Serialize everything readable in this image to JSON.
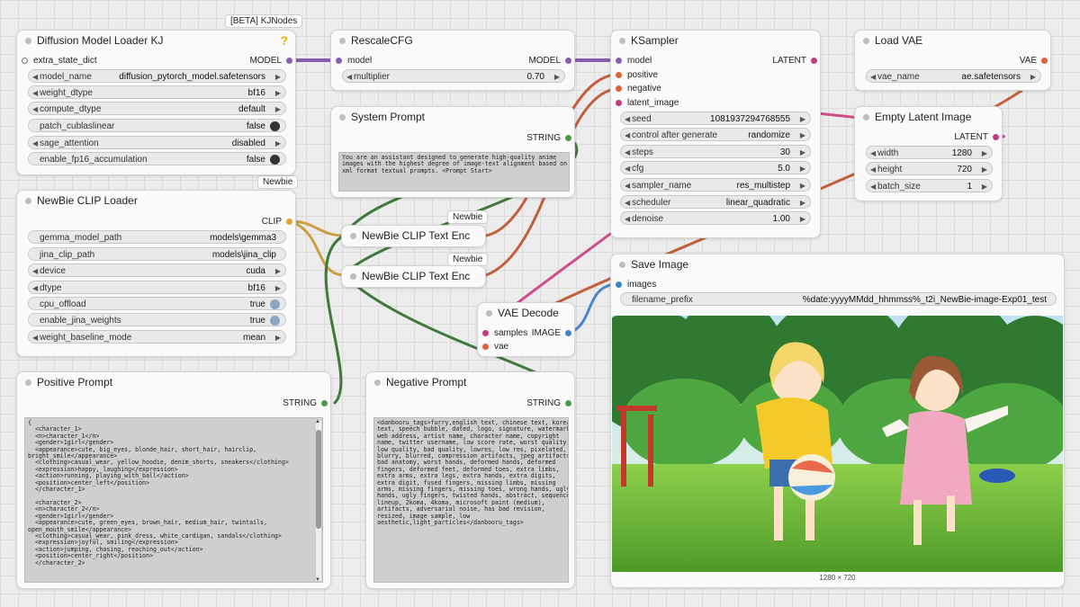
{
  "colors": {
    "model": "#8a5cad",
    "clip": "#e8a33a",
    "string": "#4f9a4a",
    "latent": "#c43c7f",
    "vae": "#e0603a",
    "image": "#3d85c6",
    "wire_clip": "#c9a040",
    "wire_string": "#3f7a3a",
    "wire_model": "#8a5cad",
    "wire_latent": "#cc4f8a",
    "wire_vae": "#c0603c",
    "wire_image": "#4a86c8"
  },
  "badges": {
    "kjnodes": "[BETA] KJNodes",
    "newbie_loader": "Newbie",
    "newbie_enc1": "Newbie",
    "newbie_enc2": "Newbie"
  },
  "diffusion_loader": {
    "title": "Diffusion Model Loader KJ",
    "help_icon": "?",
    "input": "extra_state_dict",
    "output": "MODEL",
    "widgets": [
      {
        "label": "model_name",
        "value": "diffusion_pytorch_model.safetensors"
      },
      {
        "label": "weight_dtype",
        "value": "bf16"
      },
      {
        "label": "compute_dtype",
        "value": "default"
      },
      {
        "label": "patch_cublaslinear",
        "value": "false"
      },
      {
        "label": "sage_attention",
        "value": "disabled"
      },
      {
        "label": "enable_fp16_accumulation",
        "value": "false"
      }
    ]
  },
  "clip_loader": {
    "title": "NewBie CLIP Loader",
    "output": "CLIP",
    "widgets": [
      {
        "label": "gemma_model_path",
        "value": "models\\gemma3"
      },
      {
        "label": "jina_clip_path",
        "value": "models\\jina_clip"
      },
      {
        "label": "device",
        "value": "cuda"
      },
      {
        "label": "dtype",
        "value": "bf16"
      },
      {
        "label": "cpu_offload",
        "value": "true"
      },
      {
        "label": "enable_jina_weights",
        "value": "true"
      },
      {
        "label": "weight_baseline_mode",
        "value": "mean"
      }
    ]
  },
  "rescale": {
    "title": "RescaleCFG",
    "input": "model",
    "output": "MODEL",
    "widget": {
      "label": "multiplier",
      "value": "0.70"
    }
  },
  "system_prompt": {
    "title": "System Prompt",
    "output": "STRING",
    "text": "You are an assistant designed to generate high-quality anime\nimages with the highest degree of image-text alignment based on\nxml format textual prompts. <Prompt Start>"
  },
  "text_enc1": {
    "title": "NewBie CLIP Text Enc"
  },
  "text_enc2": {
    "title": "NewBie CLIP Text Enc"
  },
  "ksampler": {
    "title": "KSampler",
    "output": "LATENT",
    "inputs": [
      "model",
      "positive",
      "negative",
      "latent_image"
    ],
    "widgets": [
      {
        "label": "seed",
        "value": "1081937294768555"
      },
      {
        "label": "control after generate",
        "value": "randomize"
      },
      {
        "label": "steps",
        "value": "30"
      },
      {
        "label": "cfg",
        "value": "5.0"
      },
      {
        "label": "sampler_name",
        "value": "res_multistep"
      },
      {
        "label": "scheduler",
        "value": "linear_quadratic"
      },
      {
        "label": "denoise",
        "value": "1.00"
      }
    ]
  },
  "load_vae": {
    "title": "Load VAE",
    "output": "VAE",
    "widget": {
      "label": "vae_name",
      "value": "ae.safetensors"
    }
  },
  "empty_latent": {
    "title": "Empty Latent Image",
    "output": "LATENT",
    "widgets": [
      {
        "label": "width",
        "value": "1280"
      },
      {
        "label": "height",
        "value": "720"
      },
      {
        "label": "batch_size",
        "value": "1"
      }
    ]
  },
  "vae_decode": {
    "title": "VAE Decode",
    "inputs": [
      "samples",
      "vae"
    ],
    "output": "IMAGE"
  },
  "save_image": {
    "title": "Save Image",
    "input": "images",
    "widget": {
      "label": "filename_prefix",
      "value": "%date:yyyyMMdd_hhmmss%_t2i_NewBie-image-Exp01_test"
    },
    "image_size": "1280 × 720"
  },
  "positive_prompt": {
    "title": "Positive Prompt",
    "output": "STRING",
    "text": "{\n  <character_1>\n  <n>character_1</n>\n  <gender>1girl</gender>\n  <appearance>cute, big_eyes, blonde_hair, short_hair, hairclip,\nbright_smile</appearance>\n  <clothing>casual_wear, yellow_hoodie, denim_shorts, sneakers</clothing>\n  <expression>happy, laughing</expression>\n  <action>running, playing_with_ball</action>\n  <position>center_left</position>\n  </character_1>\n\n  <character_2>\n  <n>character_2</n>\n  <gender>1girl</gender>\n  <appearance>cute, green_eyes, brown_hair, medium_hair, twintails,\nopen_mouth_smile</appearance>\n  <clothing>casual_wear, pink_dress, white_cardigan, sandals</clothing>\n  <expression>joyful, smiling</expression>\n  <action>jumping, chasing, reaching_out</action>\n  <position>center_right</position>\n  </character_2>"
  },
  "negative_prompt": {
    "title": "Negative Prompt",
    "output": "STRING",
    "text": "<danbooru_tags>furry,english text, chinese text, korean\ntext, speech bubble, dated, logo, signature, watermark,\nweb address, artist name, character name, copyright\nname, twitter username, low score rate, worst quality,\nlow quality, bad quality, lowres, low res, pixelated,\nblurry, blurred, compression artifacts, jpeg artifacts,\nbad anatomy, worst hands, deformed hands, deformed\nfingers, deformed feet, deformed toes, extra limbs,\nextra arms, extra legs, extra hands, extra digits,\nextra digit, fused fingers, missing limbs, missing\narms, missing fingers, missing toes, wrong hands, ugly\nhands, ugly fingers, twisted hands, abstract, sequence,\nlineup, 2koma, 4koma, microsoft paint (medium),\nartifacts, adversarial noise, has bad revision,\nresized, image sample, low\naesthetic,light_particles</danbooru_tags>"
  }
}
